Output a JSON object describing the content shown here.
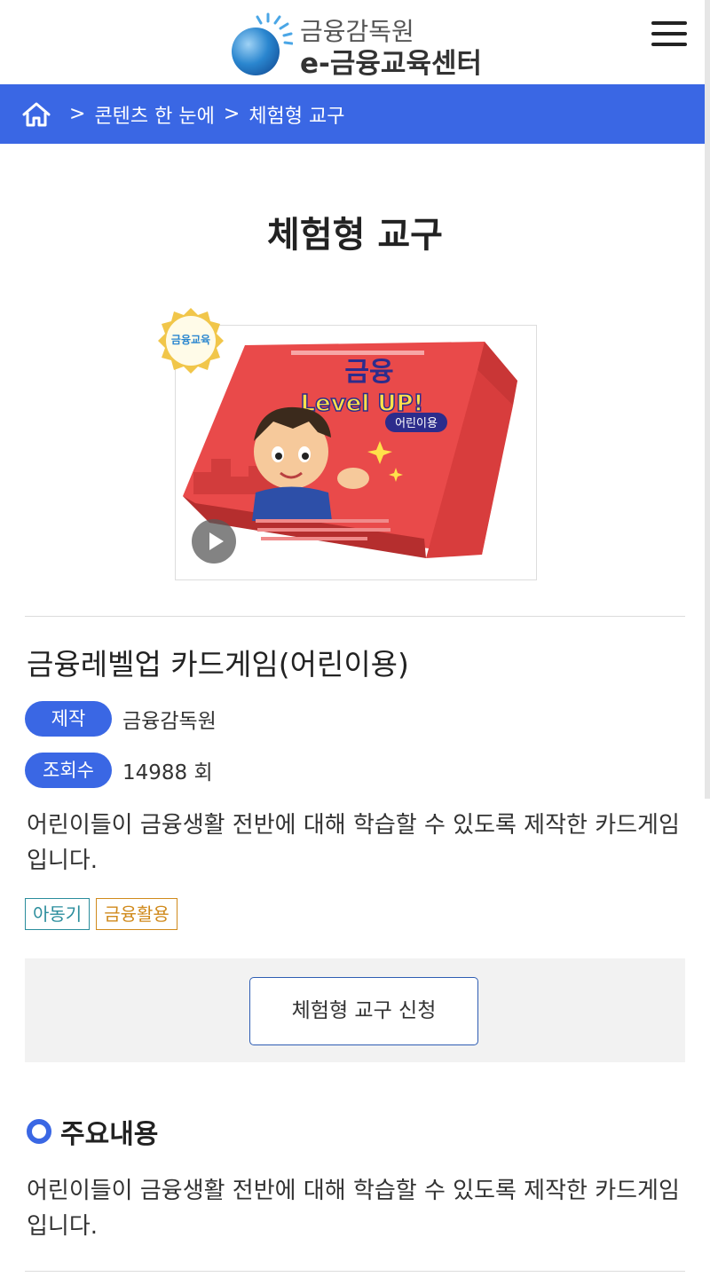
{
  "header": {
    "logo_top": "금융감독원",
    "logo_bottom": "e-금융교육센터",
    "logo_icon": "globe-logo-icon",
    "menu_icon": "hamburger-menu-icon"
  },
  "breadcrumb": {
    "home_icon": "home-icon",
    "items": [
      "콘텐츠 한 눈에",
      "체험형 교구"
    ]
  },
  "page": {
    "title": "체험형 교구"
  },
  "product": {
    "image": {
      "badge_text": "금융교육",
      "box_title": "금융",
      "box_subtitle": "Level UP!",
      "box_tag": "어린이용"
    },
    "title": "금융레벨업 카드게임(어린이용)",
    "meta": [
      {
        "label": "제작",
        "value": "금융감독원"
      },
      {
        "label": "조회수",
        "value": "14988 회"
      }
    ],
    "description": "어린이들이 금융생활 전반에 대해 학습할 수 있도록 제작한 카드게임입니다.",
    "tags": [
      "아동기",
      "금융활용"
    ],
    "apply_button": "체험형 교구 신청"
  },
  "section": {
    "heading": "주요내용",
    "body": "어린이들이 금융생활 전반에 대해 학습할 수 있도록 제작한 카드게임입니다."
  },
  "colors": {
    "primary": "#3a67e4",
    "tag_age": "#2a8d9c",
    "tag_topic": "#d08a1c"
  }
}
